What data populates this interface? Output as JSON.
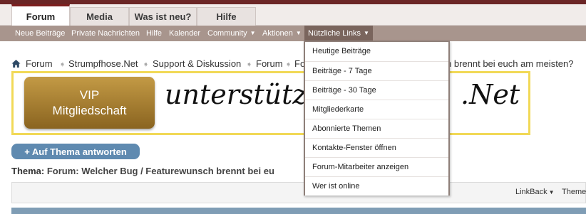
{
  "tabs": [
    {
      "label": "Forum"
    },
    {
      "label": "Media"
    },
    {
      "label": "Was ist neu?"
    },
    {
      "label": "Hilfe"
    }
  ],
  "subnav": [
    {
      "label": "Neue Beiträge"
    },
    {
      "label": "Private Nachrichten"
    },
    {
      "label": "Hilfe"
    },
    {
      "label": "Kalender"
    },
    {
      "label": "Community"
    },
    {
      "label": "Aktionen"
    },
    {
      "label": "Nützliche Links"
    }
  ],
  "breadcrumb": {
    "items": [
      "Forum",
      "Strumpfhose.Net",
      "Support & Diskussion",
      "Forum",
      "Fo"
    ],
    "tail": "n brennt bei euch am meisten?"
  },
  "banner": {
    "vip_line1": "VIP",
    "vip_line2": "Mitgliedschaft",
    "script_text": "unterstütze S",
    "script_tail": ".Net"
  },
  "reply_button": "+ Auf Thema antworten",
  "thread": {
    "label": "Thema:",
    "title": "Forum: Welcher Bug / Featurewunsch brennt bei eu"
  },
  "toolbar": {
    "linkback": "LinkBack",
    "themen": "Theme"
  },
  "dropdown": {
    "items": [
      "Heutige Beiträge",
      "Beiträge - 7 Tage",
      "Beiträge - 30 Tage",
      "Mitgliederkarte",
      "Abonnierte Themen",
      "Kontakte-Fenster öffnen",
      "Forum-Mitarbeiter anzeigen",
      "Wer ist online"
    ]
  },
  "colors": {
    "accent": "#7d1f1f",
    "subnav": "#a8958d",
    "reply": "#5f8ab0",
    "banner_border": "#f1d957"
  }
}
